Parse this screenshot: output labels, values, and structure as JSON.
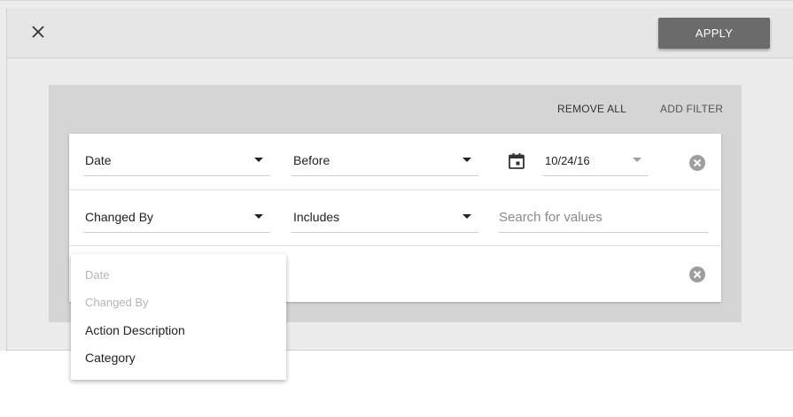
{
  "toolbar": {
    "close_icon": "close-icon",
    "apply_label": "APPLY"
  },
  "actions": {
    "remove_all_label": "REMOVE ALL",
    "add_filter_label": "ADD FILTER"
  },
  "filters": [
    {
      "field": "Date",
      "operator": "Before",
      "value": "10/24/16",
      "value_icon": "calendar-icon"
    },
    {
      "field": "Changed By",
      "operator": "Includes",
      "placeholder": "Search for values"
    },
    {
      "field": "",
      "operator": ""
    }
  ],
  "field_dropdown": {
    "options": [
      {
        "label": "Date",
        "disabled": true
      },
      {
        "label": "Changed By",
        "disabled": true
      },
      {
        "label": "Action Description",
        "disabled": false
      },
      {
        "label": "Category",
        "disabled": false
      }
    ]
  },
  "colors": {
    "apply_bg": "#6b6b6b",
    "panel_bg": "#d5d5d5",
    "dialog_bg": "#ececec",
    "remove_icon": "#9e9e9e"
  }
}
